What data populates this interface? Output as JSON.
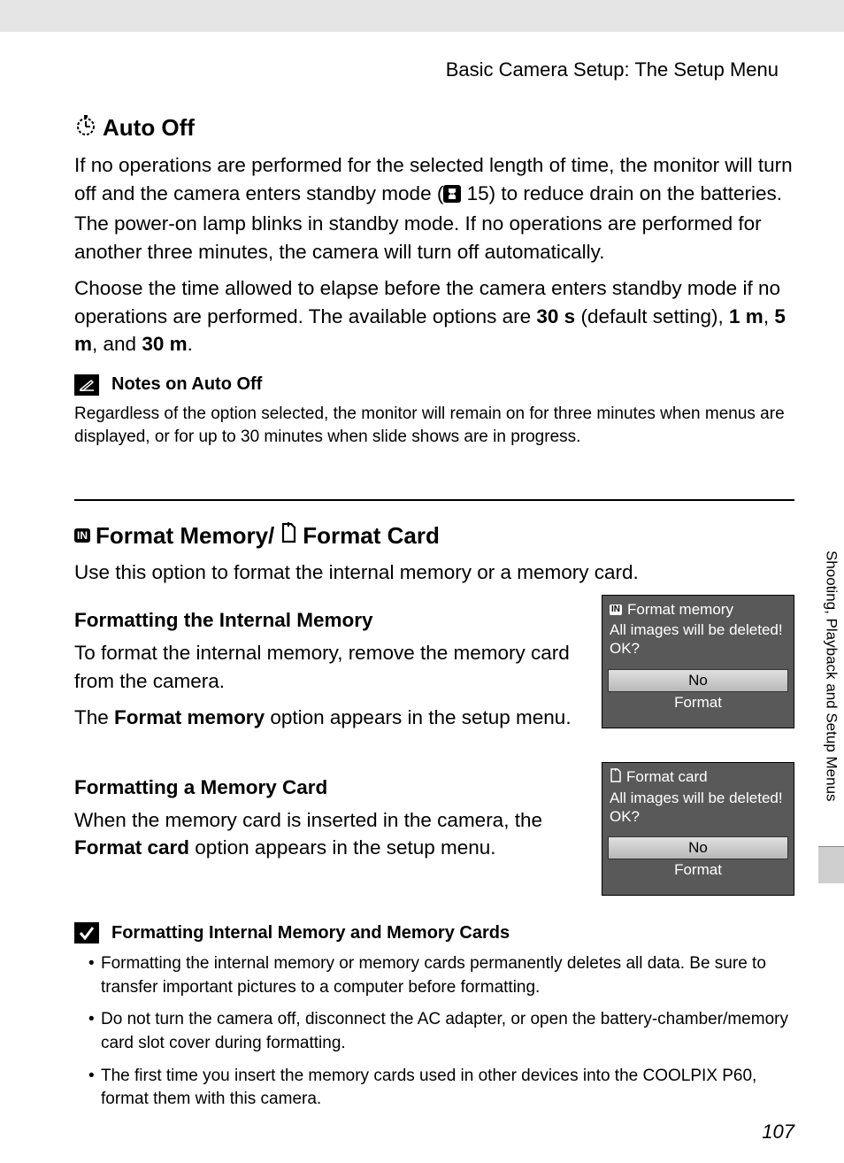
{
  "header": "Basic Camera Setup: The Setup Menu",
  "autoOff": {
    "heading": "Auto Off",
    "para1a": "If no operations are performed for the selected length of time, the monitor will turn off and the camera enters standby mode (",
    "pageRef": " 15",
    "para1b": ") to reduce drain on the batteries. The power-on lamp blinks in standby mode. If no operations are performed for another three minutes, the camera will turn off automatically.",
    "para2a": "Choose the time allowed to elapse before the camera enters standby mode if no operations are performed. The available options are ",
    "opt1": "30 s",
    "mid1": " (default setting), ",
    "opt2": "1 m",
    "mid2": ", ",
    "opt3": "5 m",
    "mid3": ", and ",
    "opt4": "30 m",
    "para2b": "."
  },
  "notes": {
    "heading": "Notes on Auto Off",
    "text": "Regardless of the option selected, the monitor will remain on for three minutes when menus are displayed, or for up to 30 minutes when slide shows are in progress."
  },
  "format": {
    "headingA": " Format Memory/",
    "headingB": " Format Card",
    "intro": "Use this option to format the internal memory or a memory card.",
    "internal": {
      "heading": "Formatting the Internal Memory",
      "p1": "To format the internal memory, remove the memory card from the camera.",
      "p2a": "The ",
      "p2bold": "Format memory",
      "p2b": " option appears in the setup menu."
    },
    "card": {
      "heading": "Formatting a Memory Card",
      "p1a": "When the memory card is inserted in the camera, the ",
      "p1bold": "Format card",
      "p1b": " option appears in the setup menu."
    }
  },
  "dialogMemory": {
    "title": "Format memory",
    "msg": "All images will be deleted! OK?",
    "no": "No",
    "format": "Format"
  },
  "dialogCard": {
    "title": "Format card",
    "msg": "All images will be deleted! OK?",
    "no": "No",
    "format": "Format"
  },
  "caution": {
    "heading": "Formatting Internal Memory and Memory Cards",
    "bullets": [
      "Formatting the internal memory or memory cards permanently deletes all data. Be sure to transfer important pictures to a computer before formatting.",
      "Do not turn the camera off, disconnect the AC adapter, or open the battery-chamber/memory card slot cover during formatting.",
      "The first time you insert the memory cards used in other devices into the COOLPIX P60, format them with this camera."
    ]
  },
  "sideTab": "Shooting, Playback and Setup Menus",
  "pageNumber": "107"
}
